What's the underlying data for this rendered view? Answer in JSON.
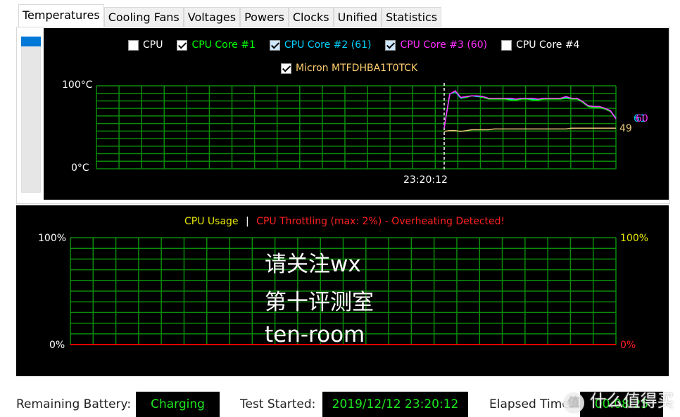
{
  "tabs": [
    "Temperatures",
    "Cooling Fans",
    "Voltages",
    "Powers",
    "Clocks",
    "Unified",
    "Statistics"
  ],
  "active_tab": "Temperatures",
  "temp_legend": [
    {
      "label": "CPU",
      "checked": false,
      "color": "#ffffff"
    },
    {
      "label": "CPU Core #1",
      "checked": true,
      "color": "#00ff00"
    },
    {
      "label": "CPU Core #2 (61)",
      "checked": true,
      "color": "#00d4ff"
    },
    {
      "label": "CPU Core #3 (60)",
      "checked": true,
      "color": "#ff30ff"
    },
    {
      "label": "CPU Core #4",
      "checked": false,
      "color": "#ffffff"
    },
    {
      "label": "Micron MTFDHBA1T0TCK",
      "checked": true,
      "color": "#ffd070"
    }
  ],
  "chart_data": [
    {
      "type": "line",
      "ylim": [
        0,
        100
      ],
      "ytick_labels": [
        "100°C",
        "0°C"
      ],
      "x_marker_label": "23:20:12",
      "grid": true,
      "series": [
        {
          "name": "CPU Core #1",
          "color": "#00ff00",
          "values": [
            49,
            90,
            93,
            85,
            86,
            88,
            87,
            86,
            84,
            84,
            84,
            84,
            83,
            83,
            84,
            84,
            83,
            83,
            84,
            84,
            84,
            84,
            85,
            84,
            84,
            80,
            75,
            74,
            74,
            72,
            69,
            61
          ]
        },
        {
          "name": "CPU Core #2",
          "color": "#00d4ff",
          "values": [
            49,
            90,
            93,
            85,
            87,
            88,
            87,
            87,
            85,
            85,
            85,
            85,
            84,
            84,
            85,
            85,
            84,
            84,
            85,
            85,
            85,
            85,
            86,
            85,
            85,
            81,
            76,
            75,
            75,
            73,
            70,
            61
          ]
        },
        {
          "name": "CPU Core #3",
          "color": "#ff30ff",
          "values": [
            49,
            90,
            94,
            86,
            87,
            88,
            88,
            87,
            85,
            85,
            85,
            85,
            85,
            84,
            85,
            85,
            85,
            84,
            85,
            85,
            85,
            85,
            87,
            85,
            85,
            81,
            76,
            75,
            75,
            73,
            70,
            60
          ]
        },
        {
          "name": "Micron MTFDHBA1T0TCK",
          "color": "#e8c878",
          "values": [
            45,
            46,
            46,
            45,
            46,
            47,
            47,
            47,
            47,
            48,
            48,
            48,
            48,
            48,
            48,
            48,
            48,
            48,
            48,
            48,
            48,
            48,
            48,
            49,
            49,
            49,
            49,
            49,
            49,
            49,
            49,
            49
          ]
        }
      ],
      "end_labels": [
        "61",
        "60",
        "49"
      ]
    },
    {
      "type": "line",
      "ylim": [
        0,
        100
      ],
      "ytick_labels_left": [
        "100%",
        "0%"
      ],
      "ytick_labels_right": [
        "100%",
        "0%"
      ],
      "grid": true,
      "legend": [
        "CPU Usage",
        "|",
        "CPU Throttling (max: 2%) - Overheating Detected!"
      ],
      "series": [
        {
          "name": "CPU Throttling",
          "color": "#ff0000",
          "values": [
            0,
            0
          ]
        }
      ]
    }
  ],
  "watermark": [
    "请关注wx",
    "第十评测室",
    "ten-room"
  ],
  "footer": {
    "battery_label": "Remaining Battery:",
    "battery_value": "Charging",
    "started_label": "Test Started:",
    "started_value": "2019/12/12 23:20:12",
    "elapsed_label": "Elapsed Time:",
    "elapsed_value": "00:08:25"
  },
  "logo_text": "值 什么值得买"
}
